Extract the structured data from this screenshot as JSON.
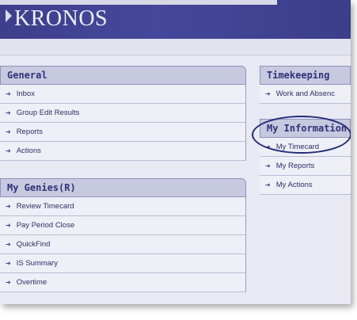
{
  "app": {
    "logo_text": "KRONOS"
  },
  "general": {
    "title": "General",
    "items": [
      "Inbox",
      "Group Edit Results",
      "Reports",
      "Actions"
    ]
  },
  "genies": {
    "title": "My Genies(R)",
    "items": [
      "Review Timecard",
      "Pay Period Close",
      "QuickFind",
      "IS Summary",
      "Overtime"
    ]
  },
  "timekeeping": {
    "title": "Timekeeping",
    "items": [
      "Work and Absenc"
    ]
  },
  "my_information": {
    "title": "My Information",
    "items": [
      "My Timecard",
      "My Reports",
      "My Actions"
    ]
  },
  "icons": {
    "item_arrow": "arrow-right-icon"
  },
  "colors": {
    "header": "#3d3f8c",
    "panel_head": "#c7c9e0",
    "highlight_ellipse": "#222a78"
  }
}
